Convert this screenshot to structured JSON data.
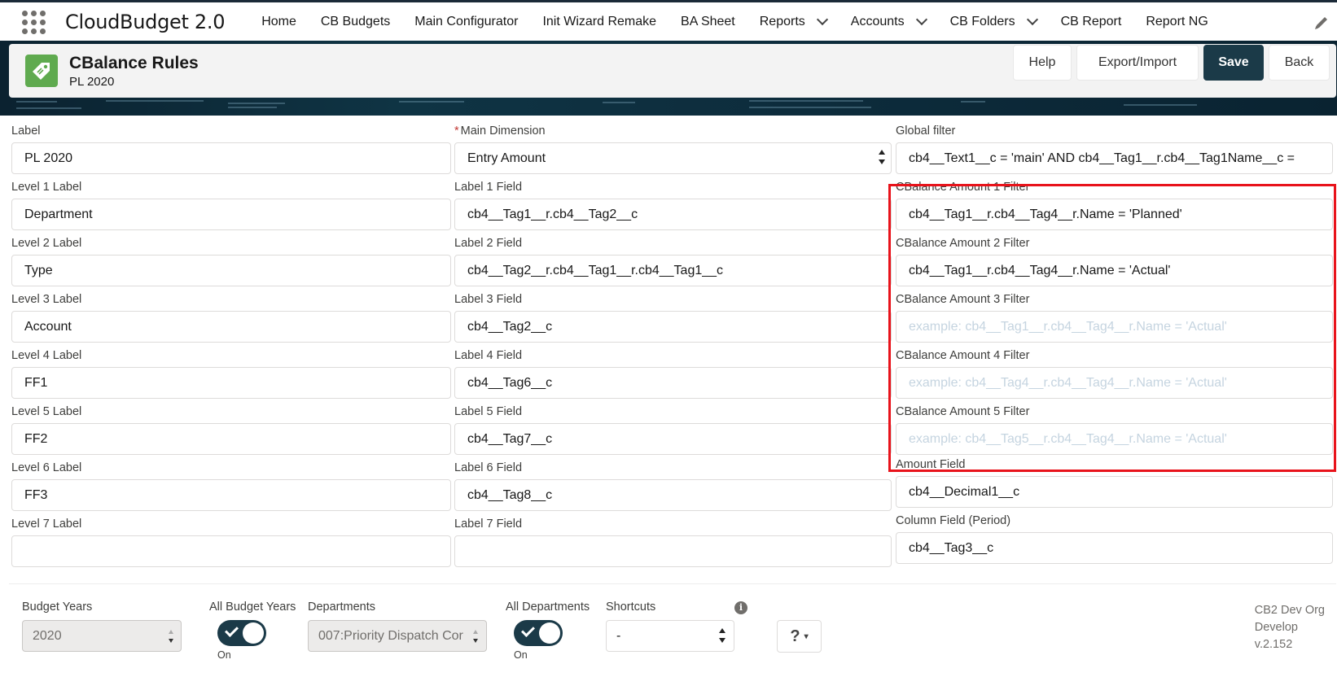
{
  "app": {
    "name": "CloudBudget 2.0"
  },
  "nav": {
    "items": [
      {
        "label": "Home",
        "dropdown": false
      },
      {
        "label": "CB Budgets",
        "dropdown": false
      },
      {
        "label": "Main Configurator",
        "dropdown": false
      },
      {
        "label": "Init Wizard Remake",
        "dropdown": false
      },
      {
        "label": "BA Sheet",
        "dropdown": false
      },
      {
        "label": "Reports",
        "dropdown": true
      },
      {
        "label": "Accounts",
        "dropdown": true
      },
      {
        "label": "CB Folders",
        "dropdown": true
      },
      {
        "label": "CB Report",
        "dropdown": false
      },
      {
        "label": "Report NG",
        "dropdown": false
      }
    ]
  },
  "header": {
    "title": "CBalance Rules",
    "subtitle": "PL 2020",
    "icon": "tag-icon",
    "buttons": {
      "help": "Help",
      "export_import": "Export/Import",
      "save": "Save",
      "back": "Back"
    }
  },
  "colors": {
    "brand_dark": "#1b3a48",
    "icon_green": "#5faa4f",
    "highlight": "#e8131b"
  },
  "form": {
    "label": {
      "label": "Label",
      "value": "PL 2020"
    },
    "main_dimension": {
      "label": "Main Dimension",
      "required": true,
      "value": "Entry Amount"
    },
    "global_filter": {
      "label": "Global filter",
      "value": "cb4__Text1__c = 'main' AND cb4__Tag1__r.cb4__Tag1Name__c ="
    },
    "levels": [
      {
        "label": "Level 1 Label",
        "value": "Department"
      },
      {
        "label": "Level 2 Label",
        "value": "Type"
      },
      {
        "label": "Level 3 Label",
        "value": "Account"
      },
      {
        "label": "Level 4 Label",
        "value": "FF1"
      },
      {
        "label": "Level 5 Label",
        "value": "FF2"
      },
      {
        "label": "Level 6 Label",
        "value": "FF3"
      },
      {
        "label": "Level 7 Label",
        "value": ""
      }
    ],
    "label_fields": [
      {
        "label": "Label 1 Field",
        "value": "cb4__Tag1__r.cb4__Tag2__c"
      },
      {
        "label": "Label 2 Field",
        "value": "cb4__Tag2__r.cb4__Tag1__r.cb4__Tag1__c"
      },
      {
        "label": "Label 3 Field",
        "value": "cb4__Tag2__c"
      },
      {
        "label": "Label 4 Field",
        "value": "cb4__Tag6__c"
      },
      {
        "label": "Label 5 Field",
        "value": "cb4__Tag7__c"
      },
      {
        "label": "Label 6 Field",
        "value": "cb4__Tag8__c"
      },
      {
        "label": "Label 7 Field",
        "value": ""
      }
    ],
    "amount_filters": [
      {
        "label": "CBalance Amount 1 Filter",
        "value": "cb4__Tag1__r.cb4__Tag4__r.Name = 'Planned'",
        "placeholder": ""
      },
      {
        "label": "CBalance Amount 2 Filter",
        "value": "cb4__Tag1__r.cb4__Tag4__r.Name = 'Actual'",
        "placeholder": ""
      },
      {
        "label": "CBalance Amount 3 Filter",
        "value": "",
        "placeholder": "example: cb4__Tag1__r.cb4__Tag4__r.Name = 'Actual'"
      },
      {
        "label": "CBalance Amount 4 Filter",
        "value": "",
        "placeholder": "example: cb4__Tag4__r.cb4__Tag4__r.Name = 'Actual'"
      },
      {
        "label": "CBalance Amount 5 Filter",
        "value": "",
        "placeholder": "example: cb4__Tag5__r.cb4__Tag4__r.Name = 'Actual'"
      }
    ],
    "amount_field": {
      "label": "Amount Field",
      "value": "cb4__Decimal1__c"
    },
    "column_field": {
      "label": "Column Field (Period)",
      "value": "cb4__Tag3__c"
    }
  },
  "footer": {
    "budget_years": {
      "label": "Budget Years",
      "value": "2020"
    },
    "all_budget_years": {
      "label": "All Budget Years",
      "state": "On"
    },
    "departments": {
      "label": "Departments",
      "value": "007:Priority Dispatch Cor"
    },
    "all_departments": {
      "label": "All Departments",
      "state": "On"
    },
    "shortcuts": {
      "label": "Shortcuts",
      "value": "-"
    },
    "help_button": "?",
    "org": "CB2 Dev Org",
    "env": "Develop",
    "version": "v.2.152"
  }
}
